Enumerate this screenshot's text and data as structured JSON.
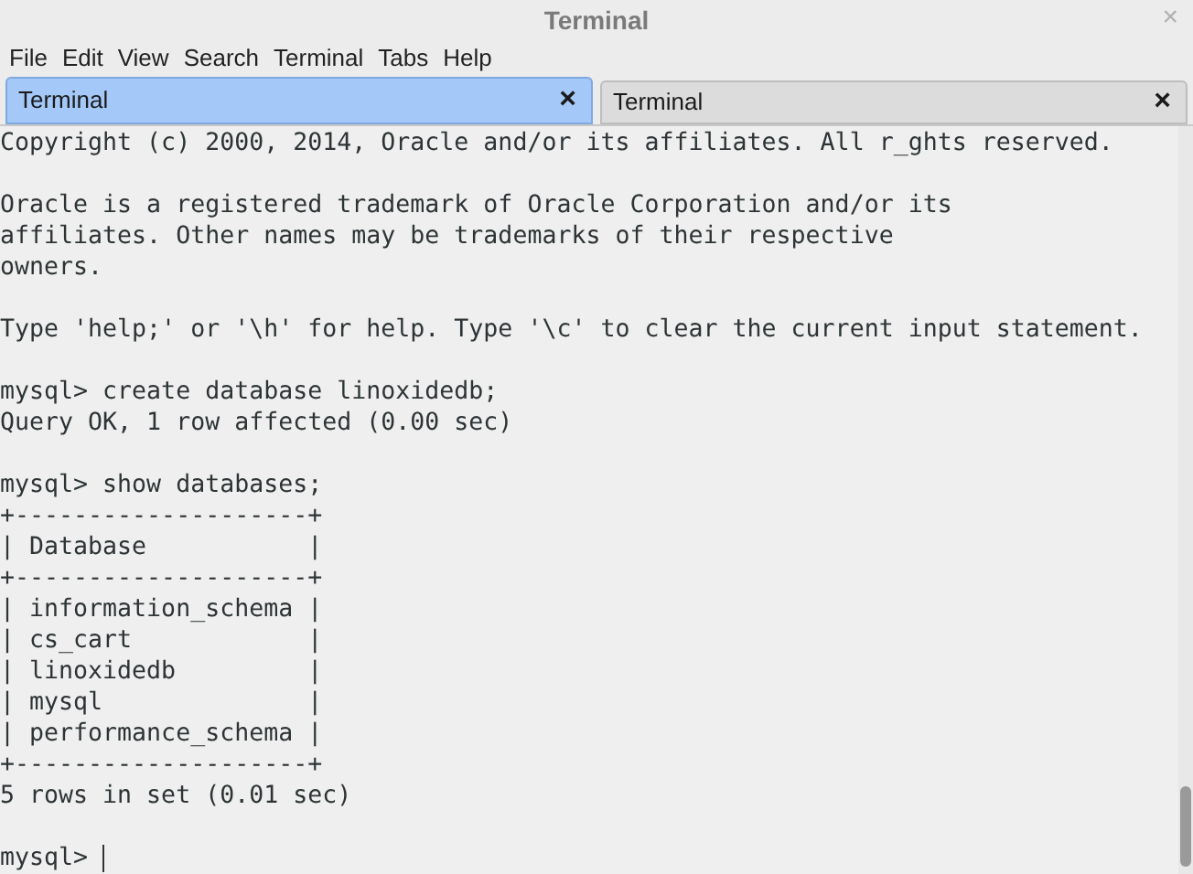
{
  "window": {
    "title": "Terminal",
    "close": "×"
  },
  "menu": [
    "File",
    "Edit",
    "View",
    "Search",
    "Terminal",
    "Tabs",
    "Help"
  ],
  "tabs": [
    {
      "label": "Terminal",
      "selected": true,
      "close": "×"
    },
    {
      "label": "Terminal",
      "selected": false,
      "close": "×"
    }
  ],
  "terminal": {
    "blocks": [
      [
        "Copyright (c) 2000, 2014, Oracle and/or its affiliates. All r_ghts reserved."
      ],
      [
        "Oracle is a registered trademark of Oracle Corporation and/or its",
        "affiliates. Other names may be trademarks of their respective",
        "owners."
      ],
      [
        "Type 'help;' or '\\h' for help. Type '\\c' to clear the current input statement."
      ],
      [
        "mysql> create database linoxidedb;",
        "Query OK, 1 row affected (0.00 sec)"
      ],
      [
        "mysql> show databases;",
        "+--------------------+",
        "| Database           |",
        "+--------------------+",
        "| information_schema |",
        "| cs_cart            |",
        "| linoxidedb         |",
        "| mysql              |",
        "| performance_schema |",
        "+--------------------+",
        "5 rows in set (0.01 sec)"
      ]
    ],
    "prompt": "mysql> "
  }
}
